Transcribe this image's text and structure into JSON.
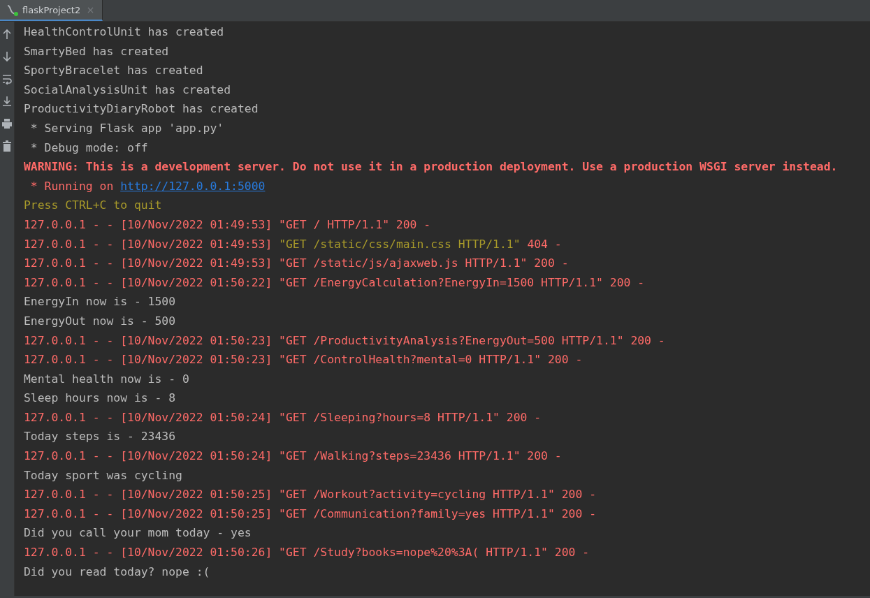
{
  "tabs": [
    {
      "label": "flaskProject2",
      "selected": true
    }
  ],
  "console_lines": [
    {
      "segments": [
        {
          "kind": "normal",
          "text": "HealthControlUnit has created"
        }
      ]
    },
    {
      "segments": [
        {
          "kind": "normal",
          "text": "SmartyBed has created"
        }
      ]
    },
    {
      "segments": [
        {
          "kind": "normal",
          "text": "SportyBracelet has created"
        }
      ]
    },
    {
      "segments": [
        {
          "kind": "normal",
          "text": "SocialAnalysisUnit has created"
        }
      ]
    },
    {
      "segments": [
        {
          "kind": "normal",
          "text": "ProductivityDiaryRobot has created"
        }
      ]
    },
    {
      "segments": [
        {
          "kind": "normal",
          "text": " * Serving Flask app 'app.py'"
        }
      ]
    },
    {
      "segments": [
        {
          "kind": "normal",
          "text": " * Debug mode: off"
        }
      ]
    },
    {
      "segments": [
        {
          "kind": "warning",
          "text": "WARNING: This is a development server. Do not use it in a production deployment. Use a production WSGI server instead."
        }
      ]
    },
    {
      "segments": [
        {
          "kind": "error",
          "text": " * Running on "
        },
        {
          "kind": "link",
          "text": "http://127.0.0.1:5000"
        }
      ]
    },
    {
      "segments": [
        {
          "kind": "notice",
          "text": "Press CTRL+C to quit"
        }
      ]
    },
    {
      "segments": [
        {
          "kind": "error",
          "text": "127.0.0.1 - - [10/Nov/2022 01:49:53] \"GET / HTTP/1.1\" 200 -"
        }
      ]
    },
    {
      "segments": [
        {
          "kind": "error",
          "text": "127.0.0.1 - - [10/Nov/2022 01:49:53] "
        },
        {
          "kind": "notice",
          "text": "\"GET /static/css/main.css HTTP/1.1\""
        },
        {
          "kind": "error",
          "text": " 404 -"
        }
      ]
    },
    {
      "segments": [
        {
          "kind": "error",
          "text": "127.0.0.1 - - [10/Nov/2022 01:49:53] \"GET /static/js/ajaxweb.js HTTP/1.1\" 200 -"
        }
      ]
    },
    {
      "segments": [
        {
          "kind": "error",
          "text": "127.0.0.1 - - [10/Nov/2022 01:50:22] \"GET /EnergyCalculation?EnergyIn=1500 HTTP/1.1\" 200 -"
        }
      ]
    },
    {
      "segments": [
        {
          "kind": "normal",
          "text": "EnergyIn now is - 1500"
        }
      ]
    },
    {
      "segments": [
        {
          "kind": "normal",
          "text": "EnergyOut now is - 500"
        }
      ]
    },
    {
      "segments": [
        {
          "kind": "error",
          "text": "127.0.0.1 - - [10/Nov/2022 01:50:23] \"GET /ProductivityAnalysis?EnergyOut=500 HTTP/1.1\" 200 -"
        }
      ]
    },
    {
      "segments": [
        {
          "kind": "error",
          "text": "127.0.0.1 - - [10/Nov/2022 01:50:23] \"GET /ControlHealth?mental=0 HTTP/1.1\" 200 -"
        }
      ]
    },
    {
      "segments": [
        {
          "kind": "normal",
          "text": "Mental health now is - 0"
        }
      ]
    },
    {
      "segments": [
        {
          "kind": "normal",
          "text": "Sleep hours now is - 8"
        }
      ]
    },
    {
      "segments": [
        {
          "kind": "error",
          "text": "127.0.0.1 - - [10/Nov/2022 01:50:24] \"GET /Sleeping?hours=8 HTTP/1.1\" 200 -"
        }
      ]
    },
    {
      "segments": [
        {
          "kind": "normal",
          "text": "Today steps is - 23436"
        }
      ]
    },
    {
      "segments": [
        {
          "kind": "error",
          "text": "127.0.0.1 - - [10/Nov/2022 01:50:24] \"GET /Walking?steps=23436 HTTP/1.1\" 200 -"
        }
      ]
    },
    {
      "segments": [
        {
          "kind": "normal",
          "text": "Today sport was cycling"
        }
      ]
    },
    {
      "segments": [
        {
          "kind": "error",
          "text": "127.0.0.1 - - [10/Nov/2022 01:50:25] \"GET /Workout?activity=cycling HTTP/1.1\" 200 -"
        }
      ]
    },
    {
      "segments": [
        {
          "kind": "error",
          "text": "127.0.0.1 - - [10/Nov/2022 01:50:25] \"GET /Communication?family=yes HTTP/1.1\" 200 -"
        }
      ]
    },
    {
      "segments": [
        {
          "kind": "normal",
          "text": "Did you call your mom today - yes"
        }
      ]
    },
    {
      "segments": [
        {
          "kind": "error",
          "text": "127.0.0.1 - - [10/Nov/2022 01:50:26] \"GET /Study?books=nope%20%3A( HTTP/1.1\" 200 -"
        }
      ]
    },
    {
      "segments": [
        {
          "kind": "normal",
          "text": "Did you read today? nope :("
        }
      ]
    }
  ]
}
